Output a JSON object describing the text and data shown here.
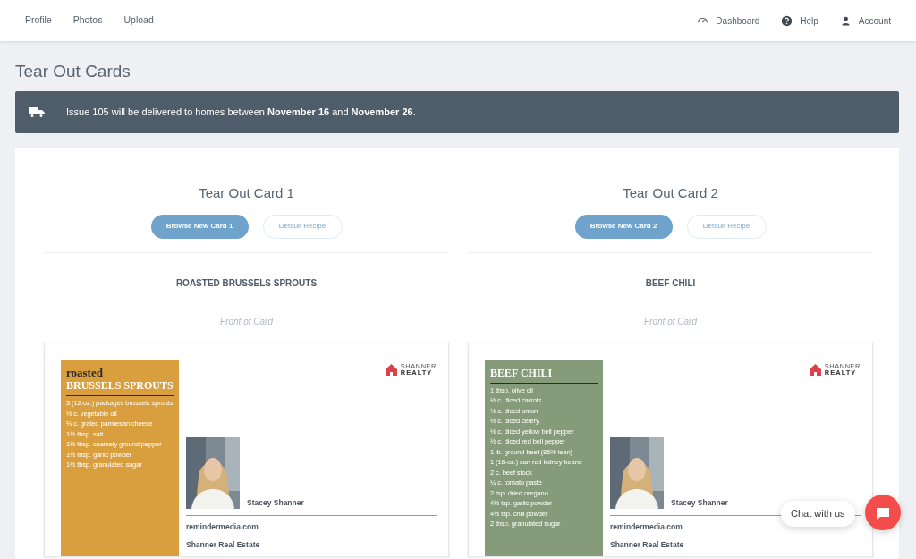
{
  "nav": {
    "left": [
      {
        "label": "Profile"
      },
      {
        "label": "Photos"
      },
      {
        "label": "Upload"
      }
    ],
    "right": [
      {
        "label": "Dashboard",
        "kind": "gauge"
      },
      {
        "label": "Help",
        "kind": "help"
      },
      {
        "label": "Account",
        "kind": "user"
      }
    ]
  },
  "page_title": "Tear Out Cards",
  "banner": {
    "text": "Issue 105 will be delivered to homes between **November 16** and **November 26**."
  },
  "cards": [
    {
      "heading": "Tear Out Card 1",
      "browse_button": "Browse New Card 1",
      "default_button": {
        "label": "Default Recipe",
        "disabled": true
      },
      "recipe_name": "ROASTED BRUSSELS SPROUTS",
      "side_label": "Front of Card",
      "preview": {
        "color": "#d99f3f",
        "title_small": "roasted",
        "title": "BRUSSELS SPROUTS",
        "ingredients": [
          "3 (12-oz.) packages brussels sprouts",
          "½ c. vegetable oil",
          "⅔ c. grated parmesan cheese",
          "1½ tbsp. salt",
          "1½ tbsp. coarsely ground pepper",
          "1½ tbsp. garlic powder",
          "1½ tbsp. granulated sugar"
        ],
        "logo_top": "SHANNER",
        "logo_bottom": "REALTY",
        "agent": "Stacey Shanner",
        "website": "remindermedia.com",
        "company": "Shanner Real Estate"
      }
    },
    {
      "heading": "Tear Out Card 2",
      "browse_button": "Browse New Card 2",
      "default_button": {
        "label": "Default Recipe",
        "disabled": true
      },
      "recipe_name": "BEEF CHILI",
      "side_label": "Front of Card",
      "preview": {
        "color": "#869b7a",
        "title": "BEEF CHILI",
        "ingredients": [
          "1 tbsp. olive oil",
          "½ c. diced carrots",
          "½ c. diced onion",
          "½ c. diced celery",
          "½ c. diced yellow bell pepper",
          "½ c. diced red bell pepper",
          "1 lb. ground beef (85% lean)",
          "1 (16-oz.) can red kidney beans",
          "2 c. beef stock",
          "¼ c. tomato paste",
          "2 tsp. dried oregano",
          "4½ tsp. garlic powder",
          "4½ tsp. chili powder",
          "2 tbsp. granulated sugar"
        ],
        "logo_top": "SHANNER",
        "logo_bottom": "REALTY",
        "agent": "Stacey Shanner",
        "website": "remindermedia.com",
        "company": "Shanner Real Estate"
      }
    }
  ],
  "chat": {
    "label": "Chat with us"
  }
}
